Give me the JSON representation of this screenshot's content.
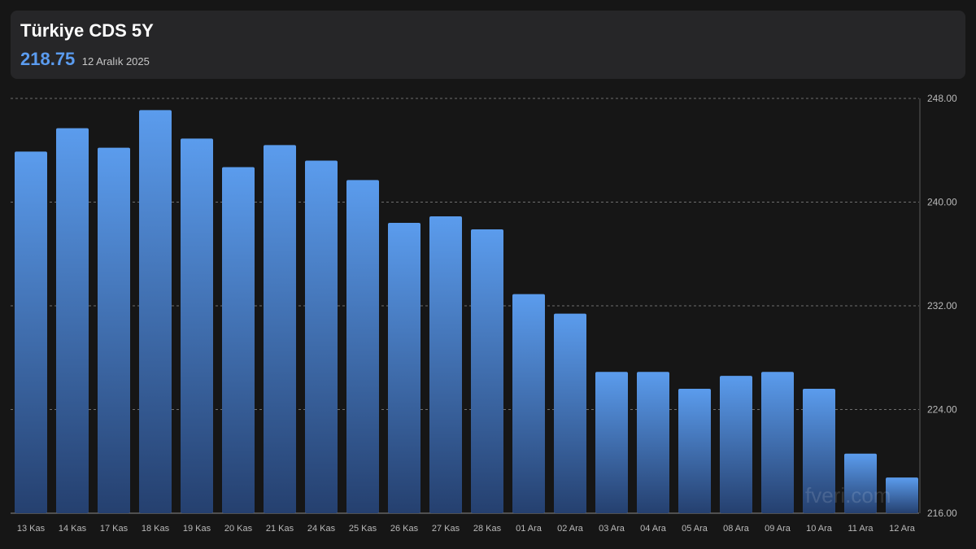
{
  "header": {
    "title": "Türkiye CDS 5Y",
    "current_value": "218.75",
    "date": "12 Aralık 2025"
  },
  "watermark": "fveri.com",
  "colors": {
    "background": "#161616",
    "card": "#262628",
    "accent": "#5b9cf0",
    "bar_top": "#5b9ced",
    "bar_bottom": "#25406f",
    "grid": "#6e6e6e",
    "tick_text": "#b9b9b9"
  },
  "chart_data": {
    "type": "bar",
    "title": "",
    "xlabel": "",
    "ylabel": "",
    "ylim": [
      216,
      248
    ],
    "y_ticks": [
      "248.00",
      "240.00",
      "232.00",
      "224.00",
      "216.00"
    ],
    "y_tick_values": [
      248,
      240,
      232,
      224,
      216
    ],
    "y_axis_position": "right",
    "grid": true,
    "categories": [
      "13 Kas",
      "14 Kas",
      "17 Kas",
      "18 Kas",
      "19 Kas",
      "20 Kas",
      "21 Kas",
      "24 Kas",
      "25 Kas",
      "26 Kas",
      "27 Kas",
      "28 Kas",
      "01 Ara",
      "02 Ara",
      "03 Ara",
      "04 Ara",
      "05 Ara",
      "08 Ara",
      "09 Ara",
      "10 Ara",
      "11 Ara",
      "12 Ara"
    ],
    "values": [
      243.9,
      245.7,
      244.2,
      247.1,
      244.9,
      242.7,
      244.4,
      243.2,
      241.7,
      238.4,
      238.9,
      237.9,
      232.9,
      231.4,
      226.9,
      226.9,
      225.6,
      226.6,
      226.9,
      225.6,
      220.6,
      218.75
    ]
  }
}
